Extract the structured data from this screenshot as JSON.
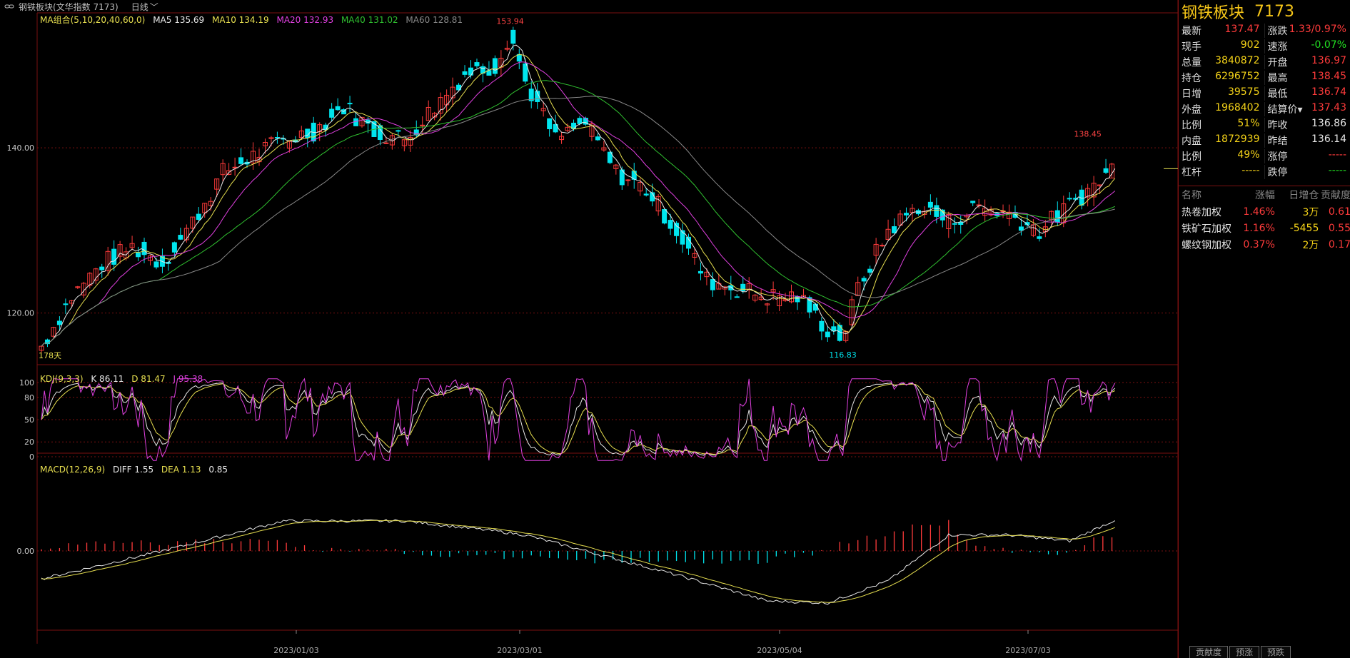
{
  "topbar": {
    "title": "钢铁板块(文华指数 7173)",
    "period": "日线"
  },
  "main_legend": {
    "ma_label": "MA组合(5,10,20,40,60,0)",
    "ma5": "MA5 135.69",
    "ma10": "MA10 134.19",
    "ma20": "MA20 132.93",
    "ma40": "MA40 131.02",
    "ma60": "MA60 128.81"
  },
  "kdj_legend": {
    "label": "KDJ(9,3,3)",
    "k": "K 86.11",
    "d": "D 81.47",
    "j": "J 95.38"
  },
  "macd_legend": {
    "label": "MACD(12,26,9)",
    "diff": "DIFF 1.55",
    "dea": "DEA 1.13",
    "macd": "0.85"
  },
  "annotations": {
    "high": "153.94",
    "low": "116.83",
    "last_high": "138.45",
    "days": "178天"
  },
  "y_labels": {
    "main": [
      "140.00",
      "120.00"
    ],
    "kdj": [
      "100",
      "80",
      "50",
      "20",
      "0"
    ],
    "macd": [
      "0.00"
    ]
  },
  "x_labels": [
    "2023/01/03",
    "2023/03/01",
    "2023/05/04",
    "2023/07/03"
  ],
  "panel": {
    "name": "钢铁板块",
    "code": "7173",
    "quotes": [
      [
        {
          "label": "最新",
          "value": "137.47",
          "color": "red"
        },
        {
          "label": "涨跌",
          "value": "1.33/0.97%",
          "color": "red"
        }
      ],
      [
        {
          "label": "现手",
          "value": "902",
          "color": "yel"
        },
        {
          "label": "速涨",
          "value": "-0.07%",
          "color": "green"
        }
      ],
      [
        {
          "label": "总量",
          "value": "3840872",
          "color": "yel"
        },
        {
          "label": "开盘",
          "value": "136.97",
          "color": "red"
        }
      ],
      [
        {
          "label": "持仓",
          "value": "6296752",
          "color": "yel"
        },
        {
          "label": "最高",
          "value": "138.45",
          "color": "red"
        }
      ],
      [
        {
          "label": "日增",
          "value": "39575",
          "color": "yel"
        },
        {
          "label": "最低",
          "value": "136.74",
          "color": "red"
        }
      ],
      [
        {
          "label": "外盘",
          "value": "1968402",
          "color": "yel"
        },
        {
          "label": "结算价▾",
          "value": "137.43",
          "color": "red"
        }
      ],
      [
        {
          "label": "比例",
          "value": "51%",
          "color": "yel"
        },
        {
          "label": "昨收",
          "value": "136.86",
          "color": "wht"
        }
      ],
      [
        {
          "label": "内盘",
          "value": "1872939",
          "color": "yel"
        },
        {
          "label": "昨结",
          "value": "136.14",
          "color": "wht"
        }
      ],
      [
        {
          "label": "比例",
          "value": "49%",
          "color": "yel"
        },
        {
          "label": "涨停",
          "value": "-----",
          "color": "red"
        }
      ],
      [
        {
          "label": "杠杆",
          "value": "-----",
          "color": "yel"
        },
        {
          "label": "跌停",
          "value": "-----",
          "color": "green"
        }
      ]
    ],
    "contrib_headers": [
      "名称",
      "涨幅",
      "日增仓",
      "贡献度"
    ],
    "contrib_rows": [
      {
        "name": "热卷加权",
        "chg": "1.46%",
        "oi": "3万",
        "contrib": "0.61"
      },
      {
        "name": "铁矿石加权",
        "chg": "1.16%",
        "oi": "-5455",
        "contrib": "0.55"
      },
      {
        "name": "螺纹钢加权",
        "chg": "0.37%",
        "oi": "2万",
        "contrib": "0.17"
      }
    ],
    "tabs": [
      "贡献度",
      "预涨",
      "预跌"
    ]
  },
  "colors": {
    "up": "#ff3b3b",
    "down": "#00e5ee",
    "ma5": "#e8e8e8",
    "ma10": "#e8e050",
    "ma20": "#e040e0",
    "ma40": "#30c030",
    "ma60": "#888888",
    "grid": "#7a1010"
  },
  "chart_data": {
    "type": "candlestick",
    "x_range": [
      "2022-11",
      "2023-08"
    ],
    "ylim": [
      114,
      156
    ],
    "price_keypoints": [
      [
        0,
        116
      ],
      [
        10,
        122
      ],
      [
        20,
        126
      ],
      [
        30,
        128
      ],
      [
        40,
        126
      ],
      [
        50,
        131
      ],
      [
        60,
        137
      ],
      [
        70,
        139
      ],
      [
        80,
        141
      ],
      [
        90,
        142
      ],
      [
        100,
        145
      ],
      [
        110,
        142
      ],
      [
        120,
        141
      ],
      [
        130,
        145
      ],
      [
        140,
        149
      ],
      [
        150,
        150
      ],
      [
        155,
        154
      ],
      [
        160,
        148
      ],
      [
        170,
        141
      ],
      [
        180,
        143
      ],
      [
        190,
        137
      ],
      [
        200,
        135
      ],
      [
        210,
        130
      ],
      [
        220,
        124
      ],
      [
        230,
        123
      ],
      [
        240,
        122
      ],
      [
        250,
        122
      ],
      [
        260,
        118
      ],
      [
        265,
        117
      ],
      [
        270,
        123
      ],
      [
        280,
        130
      ],
      [
        290,
        133
      ],
      [
        300,
        131
      ],
      [
        310,
        133
      ],
      [
        320,
        132
      ],
      [
        330,
        130
      ],
      [
        340,
        133
      ],
      [
        350,
        136
      ],
      [
        355,
        138
      ]
    ],
    "macd_keypoints": [
      [
        0,
        -1.4
      ],
      [
        40,
        0
      ],
      [
        80,
        1.5
      ],
      [
        120,
        1.5
      ],
      [
        150,
        1
      ],
      [
        160,
        0.8
      ],
      [
        180,
        0
      ],
      [
        210,
        -1.2
      ],
      [
        240,
        -2.5
      ],
      [
        260,
        -2.6
      ],
      [
        280,
        -1.5
      ],
      [
        300,
        0.8
      ],
      [
        320,
        0.8
      ],
      [
        340,
        0.5
      ],
      [
        355,
        1.55
      ]
    ]
  }
}
